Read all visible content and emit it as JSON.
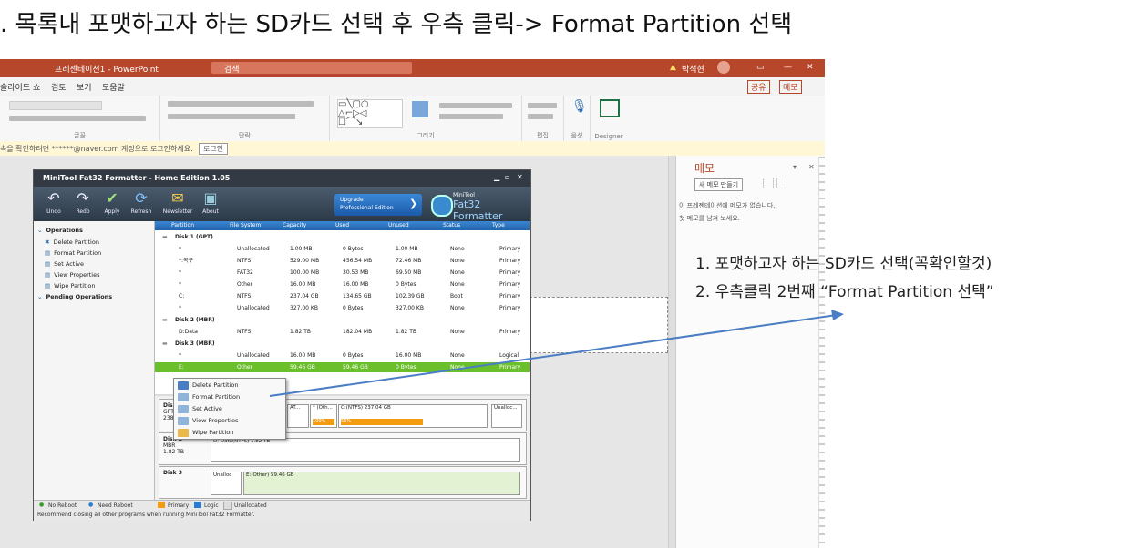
{
  "heading": ". 목록내 포맷하고자 하는 SD카드 선택 후 우측 클릭-> Format Partition 선택",
  "powerpoint": {
    "title": "프레젠테이션1 - PowerPoint",
    "search": "검색",
    "user": "박석현",
    "menu": [
      "슬라이드 쇼",
      "검토",
      "보기",
      "도움말"
    ],
    "share": "공유",
    "memo_btn": "메모",
    "ribbon_groups": [
      "글꼴",
      "단락",
      "그리기",
      "편집",
      "음성",
      "Designer"
    ],
    "notice": "속을 확인하려면 ******@naver.com 계정으로 로그인하세요.",
    "notice_btn": "로그인"
  },
  "memo_panel": {
    "title": "메모",
    "new_btn": "새 메모 만들기",
    "empty_line1": "이 프레젠테이션에 메모가 없습니다.",
    "empty_line2": "첫 메모를 남겨 보세요."
  },
  "minitool": {
    "title": "MiniTool Fat32 Formatter - Home Edition 1.05",
    "toolbar": [
      "Undo",
      "Redo",
      "Apply",
      "Refresh",
      "Newsletter",
      "About"
    ],
    "upgrade_line1": "Upgrade",
    "upgrade_line2": "Professional Edition",
    "brand_top": "MiniTool",
    "brand": "Fat32 Formatter",
    "operations_header": "Operations",
    "operations": [
      "Delete Partition",
      "Format Partition",
      "Set Active",
      "View Properties",
      "Wipe Partition"
    ],
    "pending": "Pending Operations",
    "columns": [
      "Partition",
      "File System",
      "Capacity",
      "Used",
      "Unused",
      "Status",
      "Type"
    ],
    "rows": [
      {
        "kind": "disk",
        "label": "Disk 1 (GPT)"
      },
      {
        "kind": "part",
        "cells": [
          "*",
          "Unallocated",
          "1.00 MB",
          "0 Bytes",
          "1.00 MB",
          "None",
          "Primary"
        ]
      },
      {
        "kind": "part",
        "cells": [
          "*:복구",
          "NTFS",
          "529.00 MB",
          "456.54 MB",
          "72.46 MB",
          "None",
          "Primary"
        ]
      },
      {
        "kind": "part",
        "cells": [
          "*",
          "FAT32",
          "100.00 MB",
          "30.53 MB",
          "69.50 MB",
          "None",
          "Primary"
        ]
      },
      {
        "kind": "part",
        "cells": [
          "*",
          "Other",
          "16.00 MB",
          "16.00 MB",
          "0 Bytes",
          "None",
          "Primary"
        ]
      },
      {
        "kind": "part",
        "cells": [
          "C:",
          "NTFS",
          "237.04 GB",
          "134.65 GB",
          "102.39 GB",
          "Boot",
          "Primary"
        ]
      },
      {
        "kind": "part",
        "cells": [
          "*",
          "Unallocated",
          "327.00 KB",
          "0 Bytes",
          "327.00 KB",
          "None",
          "Primary"
        ]
      },
      {
        "kind": "disk",
        "label": "Disk 2 (MBR)"
      },
      {
        "kind": "part",
        "cells": [
          "D:Data",
          "NTFS",
          "1.82 TB",
          "182.04 MB",
          "1.82 TB",
          "None",
          "Primary"
        ]
      },
      {
        "kind": "disk",
        "label": "Disk 3 (MBR)"
      },
      {
        "kind": "part",
        "cells": [
          "*",
          "Unallocated",
          "16.00 MB",
          "0 Bytes",
          "16.00 MB",
          "None",
          "Logical"
        ]
      },
      {
        "kind": "sel",
        "cells": [
          "E:",
          "Other",
          "59.46 GB",
          "59.46 GB",
          "0 Bytes",
          "None",
          "Primary"
        ]
      }
    ],
    "disk_map": [
      {
        "name": "Disk 1",
        "sub1": "GPT",
        "sub2": "238.47 GB",
        "parts": [
          "AT...",
          "* (Oth...",
          "C:(NTFS) 237.04 GB",
          "Unalloc..."
        ],
        "pct": [
          "",
          "100%",
          "56%",
          ""
        ]
      },
      {
        "name": "Disk 2",
        "sub1": "MBR",
        "sub2": "1.82 TB",
        "parts": [
          "D: Data(NTFS) 1.82 TB"
        ]
      },
      {
        "name": "Disk 3",
        "sub1": "",
        "sub2": "",
        "parts": [
          "Unalloc",
          "E:(Other) 59.46 GB"
        ]
      }
    ],
    "legend": [
      "No Reboot",
      "Need Reboot",
      "Primary",
      "Logic",
      "Unallocated"
    ],
    "status_text": "Recommend closing all other programs when running MiniTool Fat32 Formatter.",
    "context_menu": [
      "Delete Partition",
      "Format Partition",
      "Set Active",
      "View Properties",
      "Wipe Partition"
    ]
  },
  "annotation": {
    "line1": "1. 포맷하고자 하는 SD카드 선택(꼭확인할것)",
    "line2": "2. 우측클릭 2번째 “Format Partition 선택”"
  },
  "colors": {
    "ppt_red": "#b7472a",
    "selection_green": "#6abf2b",
    "arrow_blue": "#4a7ec4",
    "header_blue": "#2364ad"
  }
}
